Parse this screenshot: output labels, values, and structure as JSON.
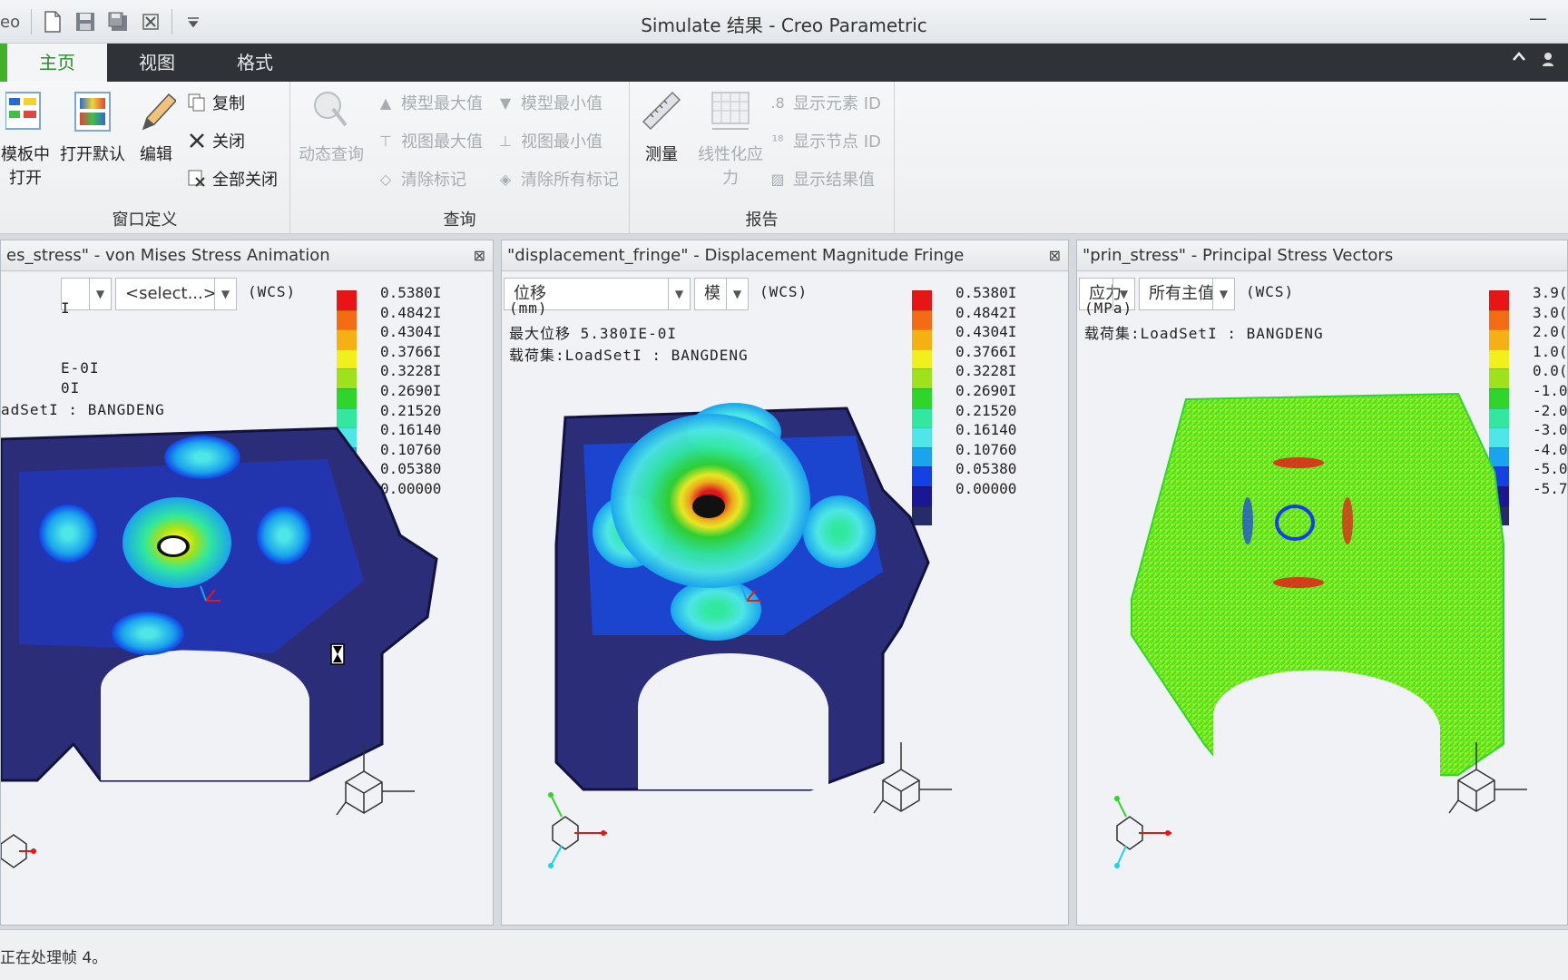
{
  "window": {
    "title": "Simulate 结果 - Creo Parametric",
    "logo": "eo"
  },
  "tabs": [
    {
      "label": "主页"
    },
    {
      "label": "视图"
    },
    {
      "label": "格式"
    }
  ],
  "ribbon": {
    "window_def": {
      "title": "窗口定义",
      "open_template_l1": "模板中",
      "open_template_l2": "打开",
      "open_default": "打开默认",
      "edit": "编辑",
      "copy": "复制",
      "close": "关闭",
      "close_all": "全部关闭"
    },
    "query": {
      "title": "查询",
      "dynamic_query": "动态查询",
      "model_max": "模型最大值",
      "model_min": "模型最小值",
      "view_max": "视图最大值",
      "view_min": "视图最小值",
      "clear_marks": "清除标记",
      "clear_all_marks": "清除所有标记"
    },
    "report": {
      "title": "报告",
      "measure": "测量",
      "linear_stress_l1": "线性化应",
      "linear_stress_l2": "力",
      "show_element_id": "显示元素 ID",
      "show_node_id": "显示节点 ID",
      "show_result_value": "显示结果值"
    }
  },
  "panels": [
    {
      "title": "es_stress\" - von Mises Stress Animation",
      "dd1_value": "",
      "dd2_value": "<select...>",
      "wcs": "(WCS)",
      "info_lines": [
        "I",
        "E-0I",
        "0I",
        "adSetI  :  BANGDENG"
      ]
    },
    {
      "title": "\"displacement_fringe\" - Displacement Magnitude Fringe",
      "dd1_value": "位移",
      "dd2_value": "模",
      "wcs": "(WCS)",
      "info_lines": [
        "(mm)",
        "最大位移  5.380IE-0I",
        "载荷集:LoadSetI  :  BANGDENG"
      ]
    },
    {
      "title": "\"prin_stress\" - Principal Stress Vectors",
      "dd1_value": "应力",
      "dd2_value": "所有主值",
      "wcs": "(WCS)",
      "info_lines": [
        "(MPa)",
        "载荷集:LoadSetI  :  BANGDENG"
      ]
    }
  ],
  "legend_values": [
    "0.5380I",
    "0.4842I",
    "0.4304I",
    "0.3766I",
    "0.3228I",
    "0.2690I",
    "0.21520",
    "0.16140",
    "0.10760",
    "0.05380",
    "0.00000"
  ],
  "legend_values_stress": [
    "3.9(",
    "3.0(",
    "2.0(",
    "1.0(",
    "0.0(",
    "-1.0(",
    "-2.0(",
    "-3.0(",
    "-4.0(",
    "-5.0(",
    "-5.7"
  ],
  "legend_colors": [
    "#e81416",
    "#f36c13",
    "#f7b014",
    "#f2ef1a",
    "#9ee21d",
    "#2fd52b",
    "#31e89e",
    "#4ee6e6",
    "#1aa3ee",
    "#1441e4",
    "#1a1696",
    "#262b6a"
  ],
  "status": {
    "message": "正在处理帧 4。"
  }
}
